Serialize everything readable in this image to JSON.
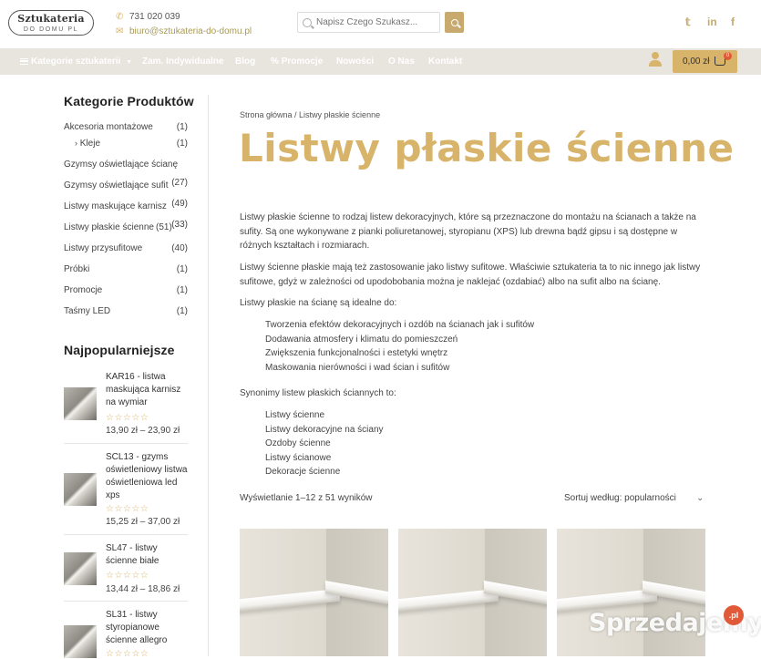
{
  "header": {
    "logo_line1": "Sztukateria",
    "logo_line2": "DO DOMU PL",
    "phone": "731 020 039",
    "email": "biuro@sztukateria-do-domu.pl",
    "search_placeholder": "Napisz Czego Szukasz...",
    "social": [
      "twitter-icon",
      "linkedin-icon",
      "facebook-icon"
    ]
  },
  "nav": {
    "items": [
      "Kategorie sztukaterii",
      "Zam. Indywidualne",
      "Blog",
      "Promocje",
      "Nowości",
      "O Nas",
      "Kontakt"
    ],
    "cart_total": "0,00 zł",
    "cart_count": "0"
  },
  "sidebar": {
    "categories_title": "Kategorie Produktów",
    "categories": [
      {
        "label": "Akcesoria montażowe",
        "count": "(1)"
      },
      {
        "label": "Kleje",
        "count": "(1)"
      },
      {
        "label": "Gzymsy oświetlające ścianę",
        "count": ""
      },
      {
        "label": "Gzymsy oświetlające sufit",
        "count": "(27)"
      },
      {
        "label": "Listwy maskujące karnisz",
        "count": "(49)"
      },
      {
        "label": "Listwy płaskie ścienne",
        "count": "(51)"
      },
      {
        "label": "Listwy przysufitowe",
        "count": "(40)"
      },
      {
        "label": "Próbki",
        "count": "(1)"
      },
      {
        "label": "Promocje",
        "count": "(1)"
      },
      {
        "label": "Taśmy LED",
        "count": "(1)"
      }
    ],
    "extra_count": "(33)",
    "popular_title": "Najpopularniejsze",
    "popular": [
      {
        "title": "KAR16 - listwa maskująca karnisz na wymiar",
        "price": "13,90 zł – 23,90 zł"
      },
      {
        "title": "SCL13 - gzyms oświetleniowy listwa oświetleniowa led xps",
        "price": "15,25 zł – 37,00 zł"
      },
      {
        "title": "SL47 - listwy ścienne białe",
        "price": "13,44 zł – 18,86 zł"
      },
      {
        "title": "SL31 - listwy styropianowe ścienne allegro",
        "price": ""
      }
    ],
    "stars": "☆☆☆☆☆"
  },
  "main": {
    "breadcrumb": "Strona główna / Listwy płaskie ścienne",
    "title": "Listwy płaskie ścienne",
    "p1": "Listwy płaskie ścienne to rodzaj listew dekoracyjnych, które są przeznaczone do montażu na ścianach a także na sufity. Są one wykonywane z pianki poliuretanowej, styropianu (XPS) lub drewna bądź gipsu i są dostępne w różnych kształtach i rozmiarach.",
    "p2": "Listwy ścienne płaskie mają też zastosowanie jako listwy sufitowe. Właściwie  sztukateria ta to nic innego jak listwy sufitowe, gdyż w zależności od upodobobania można je naklejać (ozdabiać) albo na sufit albo na ścianę.",
    "p3": "Listwy płaskie na ścianę są idealne do:",
    "list1": [
      "Tworzenia efektów dekoracyjnych i ozdób na ścianach jak i sufitów",
      "Dodawania atmosfery i klimatu do pomieszczeń",
      "Zwiększenia funkcjonalności i estetyki wnętrz",
      "Maskowania nierówności i wad ścian i sufitów"
    ],
    "p4": "Synonimy listew płaskich ściannych to:",
    "list2": [
      "Listwy ścienne",
      "Listwy dekoracyjne na ściany",
      "Ozdoby ścienne",
      "Listwy ścianowe",
      "Dekoracje ścienne"
    ],
    "result_count": "Wyświetlanie 1–12 z 51 wyników",
    "sort_label": "Sortuj według: popularności"
  },
  "watermark": {
    "text": "Sprzedajemy",
    "badge": ".pl"
  },
  "colors": {
    "accent": "#d8b36a",
    "nav_bg": "#e8e5df"
  }
}
